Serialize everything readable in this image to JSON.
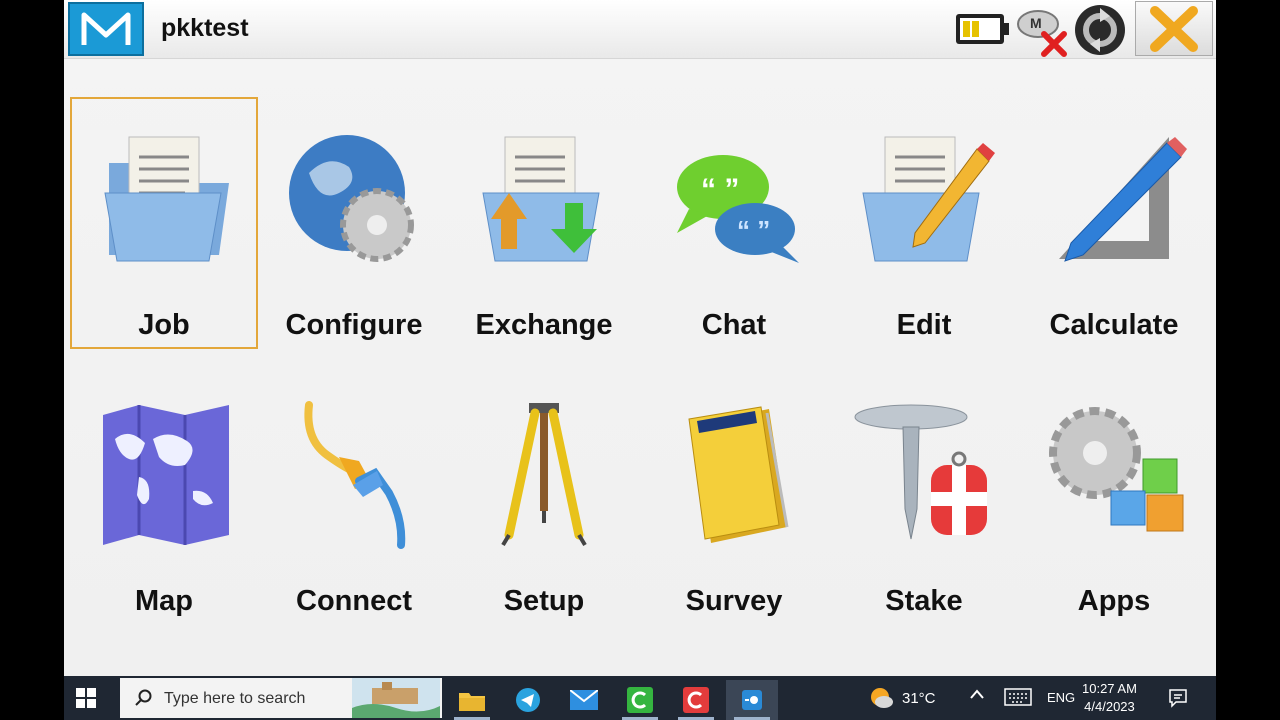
{
  "window": {
    "title": "pkktest",
    "logo_letter": "M",
    "colors": {
      "accent": "#1b9ad6",
      "selection": "#e3a73a",
      "close_x": "#f0a820"
    }
  },
  "status_icons": [
    "battery-icon",
    "sync-disconnected-icon",
    "refresh-icon",
    "close-icon"
  ],
  "menu": {
    "items": [
      {
        "label": "Job",
        "icon": "job-folder-icon",
        "selected": true
      },
      {
        "label": "Configure",
        "icon": "globe-gear-icon"
      },
      {
        "label": "Exchange",
        "icon": "exchange-folder-icon"
      },
      {
        "label": "Chat",
        "icon": "chat-bubbles-icon"
      },
      {
        "label": "Edit",
        "icon": "edit-folder-pencil-icon"
      },
      {
        "label": "Calculate",
        "icon": "pencil-square-icon"
      },
      {
        "label": "Map",
        "icon": "world-map-icon"
      },
      {
        "label": "Connect",
        "icon": "cable-icon"
      },
      {
        "label": "Setup",
        "icon": "tripod-icon"
      },
      {
        "label": "Survey",
        "icon": "notebook-icon"
      },
      {
        "label": "Stake",
        "icon": "stake-icon"
      },
      {
        "label": "Apps",
        "icon": "gear-blocks-icon"
      }
    ]
  },
  "taskbar": {
    "search_placeholder": "Type here to search",
    "weather_temp": "31°C",
    "language": "ENG",
    "time": "10:27 AM",
    "date": "4/4/2023"
  }
}
